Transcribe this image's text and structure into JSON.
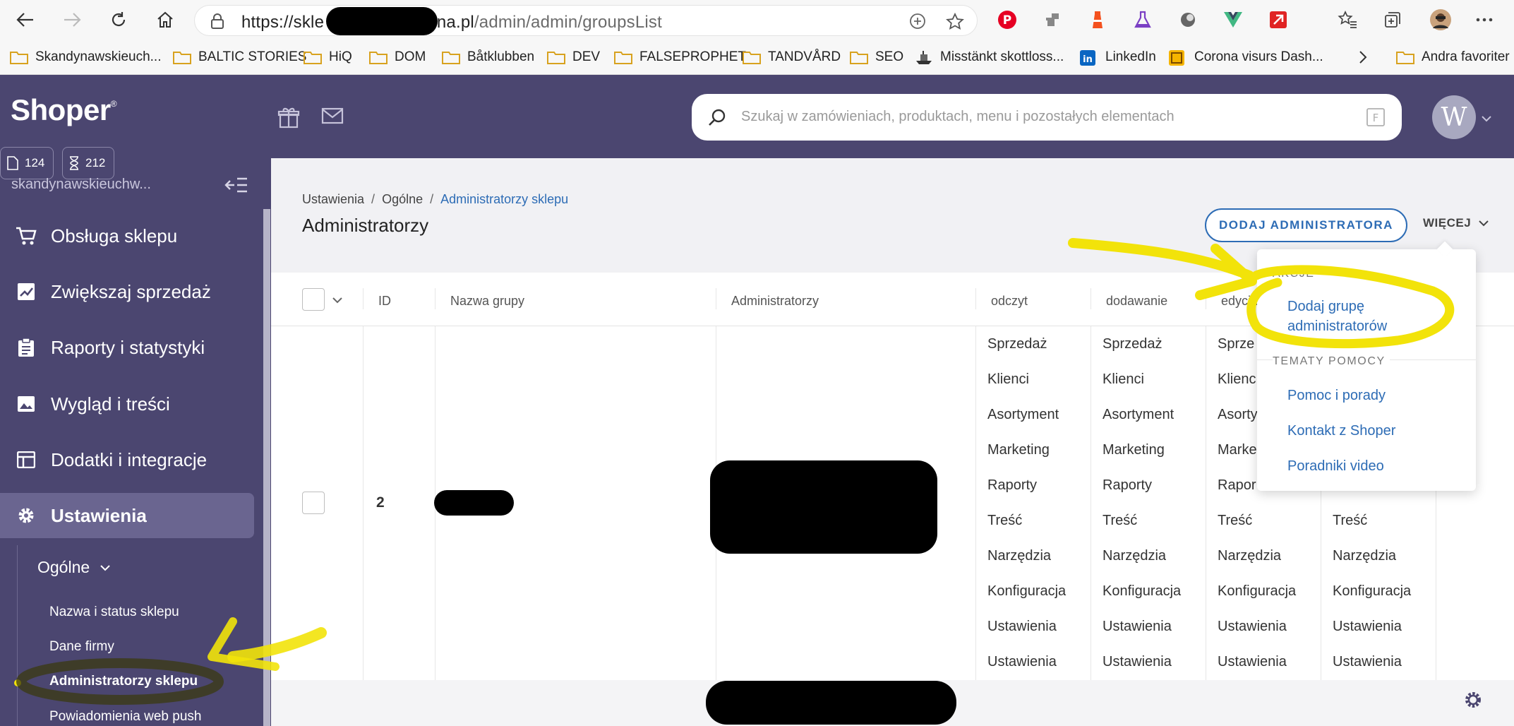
{
  "browser": {
    "url_visible_start": "https://skle",
    "url_visible_domain": "rena.pl",
    "url_visible_path": "/admin/admin/groupsList",
    "bookmarks": [
      {
        "label": "Skandynawskieuch...",
        "type": "folder"
      },
      {
        "label": "BALTIC STORIES",
        "type": "folder"
      },
      {
        "label": "HiQ",
        "type": "folder"
      },
      {
        "label": "DOM",
        "type": "folder"
      },
      {
        "label": "Båtklubben",
        "type": "folder"
      },
      {
        "label": "DEV",
        "type": "folder"
      },
      {
        "label": "FALSEPROPHET",
        "type": "folder"
      },
      {
        "label": "TANDVÅRD",
        "type": "folder"
      },
      {
        "label": "SEO",
        "type": "folder"
      },
      {
        "label": "Misstänkt skottloss...",
        "type": "page"
      },
      {
        "label": "LinkedIn",
        "type": "page"
      },
      {
        "label": "Corona visurs Dash...",
        "type": "page"
      },
      {
        "label": "Andra favoriter",
        "type": "folder"
      }
    ]
  },
  "header": {
    "logo": "Shoper",
    "logo_mark": "®",
    "search_placeholder": "Szukaj w zamówieniach, produktach, menu i pozostałych elementach",
    "avatar_initial": "W"
  },
  "sidebar": {
    "counter_orders": "124",
    "counter_pending": "212",
    "shop_name": "skandynawskieuchw...",
    "items": [
      {
        "label": "Obsługa sklepu",
        "icon": "cart-icon"
      },
      {
        "label": "Zwiększaj sprzedaż",
        "icon": "chart-icon"
      },
      {
        "label": "Raporty i statystyki",
        "icon": "clipboard-icon"
      },
      {
        "label": "Wygląd i treści",
        "icon": "image-icon"
      },
      {
        "label": "Dodatki i integracje",
        "icon": "window-icon"
      },
      {
        "label": "Ustawienia",
        "icon": "gear-icon"
      }
    ],
    "sub_heading": "Ogólne",
    "sub_items": [
      "Nazwa i status sklepu",
      "Dane firmy",
      "Administratorzy sklepu",
      "Powiadomienia web push"
    ]
  },
  "main": {
    "breadcrumbs": [
      "Ustawienia",
      "Ogólne",
      "Administratorzy sklepu"
    ],
    "title": "Administratorzy",
    "add_button": "DODAJ ADMINISTRATORA",
    "more_button": "WIĘCEJ"
  },
  "table": {
    "columns": [
      "ID",
      "Nazwa grupy",
      "Administratorzy",
      "odczyt",
      "dodawanie",
      "edycja"
    ],
    "row_id": "2",
    "permissions": [
      "Sprzedaż",
      "Klienci",
      "Asortyment",
      "Marketing",
      "Raporty",
      "Treść",
      "Narzędzia",
      "Konfiguracja",
      "Ustawienia",
      "Ustawienia"
    ],
    "col3_partial": [
      "Sprze",
      "Klienc",
      "Asorty",
      "Marke",
      "Rapor"
    ],
    "col4_tail": [
      "Treść",
      "Narzędzia",
      "Konfiguracja",
      "Ustawienia",
      "Ustawienia"
    ]
  },
  "dropdown": {
    "section_actions": "AKCJE",
    "action_add_group_line1": "Dodaj grupę",
    "action_add_group_line2": "administratorów",
    "section_help": "TEMATY POMOCY",
    "help_items": [
      "Pomoc i porady",
      "Kontakt z Shoper",
      "Poradniki video"
    ]
  },
  "colors": {
    "brand_purple": "#4b4670",
    "link_blue": "#2d6cb5",
    "highlight_yellow": "#f2e30a"
  }
}
